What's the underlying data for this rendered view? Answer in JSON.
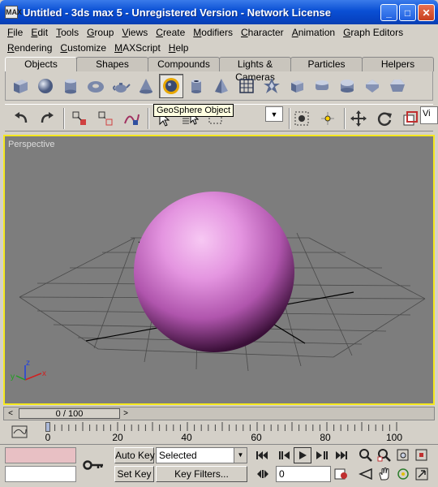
{
  "window": {
    "icon_text": "MAX",
    "title": "Untitled - 3ds max 5 - Unregistered Version - Network License",
    "minimize": "_",
    "maximize": "□",
    "close": "✕"
  },
  "menu_row1": [
    "File",
    "Edit",
    "Tools",
    "Group",
    "Views",
    "Create",
    "Modifiers",
    "Character",
    "Animation",
    "Graph Editors"
  ],
  "menu_row2": [
    "Rendering",
    "Customize",
    "MAXScript",
    "Help"
  ],
  "command_tabs": [
    "Objects",
    "Shapes",
    "Compounds",
    "Lights & Cameras",
    "Particles",
    "Helpers"
  ],
  "active_tab": "Objects",
  "object_icons": [
    "box-icon",
    "sphere-icon",
    "cylinder-icon",
    "torus-icon",
    "teapot-icon",
    "cone-icon",
    "geosphere-icon",
    "tube-icon",
    "pyramid-icon",
    "plane-icon",
    "hedra-icon",
    "chamfer-box-icon",
    "chamfer-cylinder-icon",
    "oil-tank-icon",
    "spindle-icon",
    "gengon-icon"
  ],
  "tooltip": "GeoSphere Object",
  "toolbar": {
    "vi_partial": "Vi"
  },
  "viewport": {
    "label": "Perspective",
    "axis_x": "x",
    "axis_y": "y",
    "axis_z": "z",
    "object_color": "#d07ad0"
  },
  "time_slider": {
    "prev": "<",
    "next": ">",
    "position": "0 / 100",
    "current_frame": 0,
    "total_frames": 100
  },
  "trackbar": {
    "labels": [
      "0",
      "20",
      "40",
      "60",
      "80",
      "100"
    ]
  },
  "status": {
    "auto_key": "Auto Key",
    "set_key": "Set Key",
    "key_filters": "Key Filters...",
    "selection_combo": "Selected",
    "frame_value": "0"
  },
  "colors": {
    "viewport_border": "#f5e81e",
    "viewport_bg": "#7d7d7d",
    "title_bar": "#0a4fd4"
  }
}
